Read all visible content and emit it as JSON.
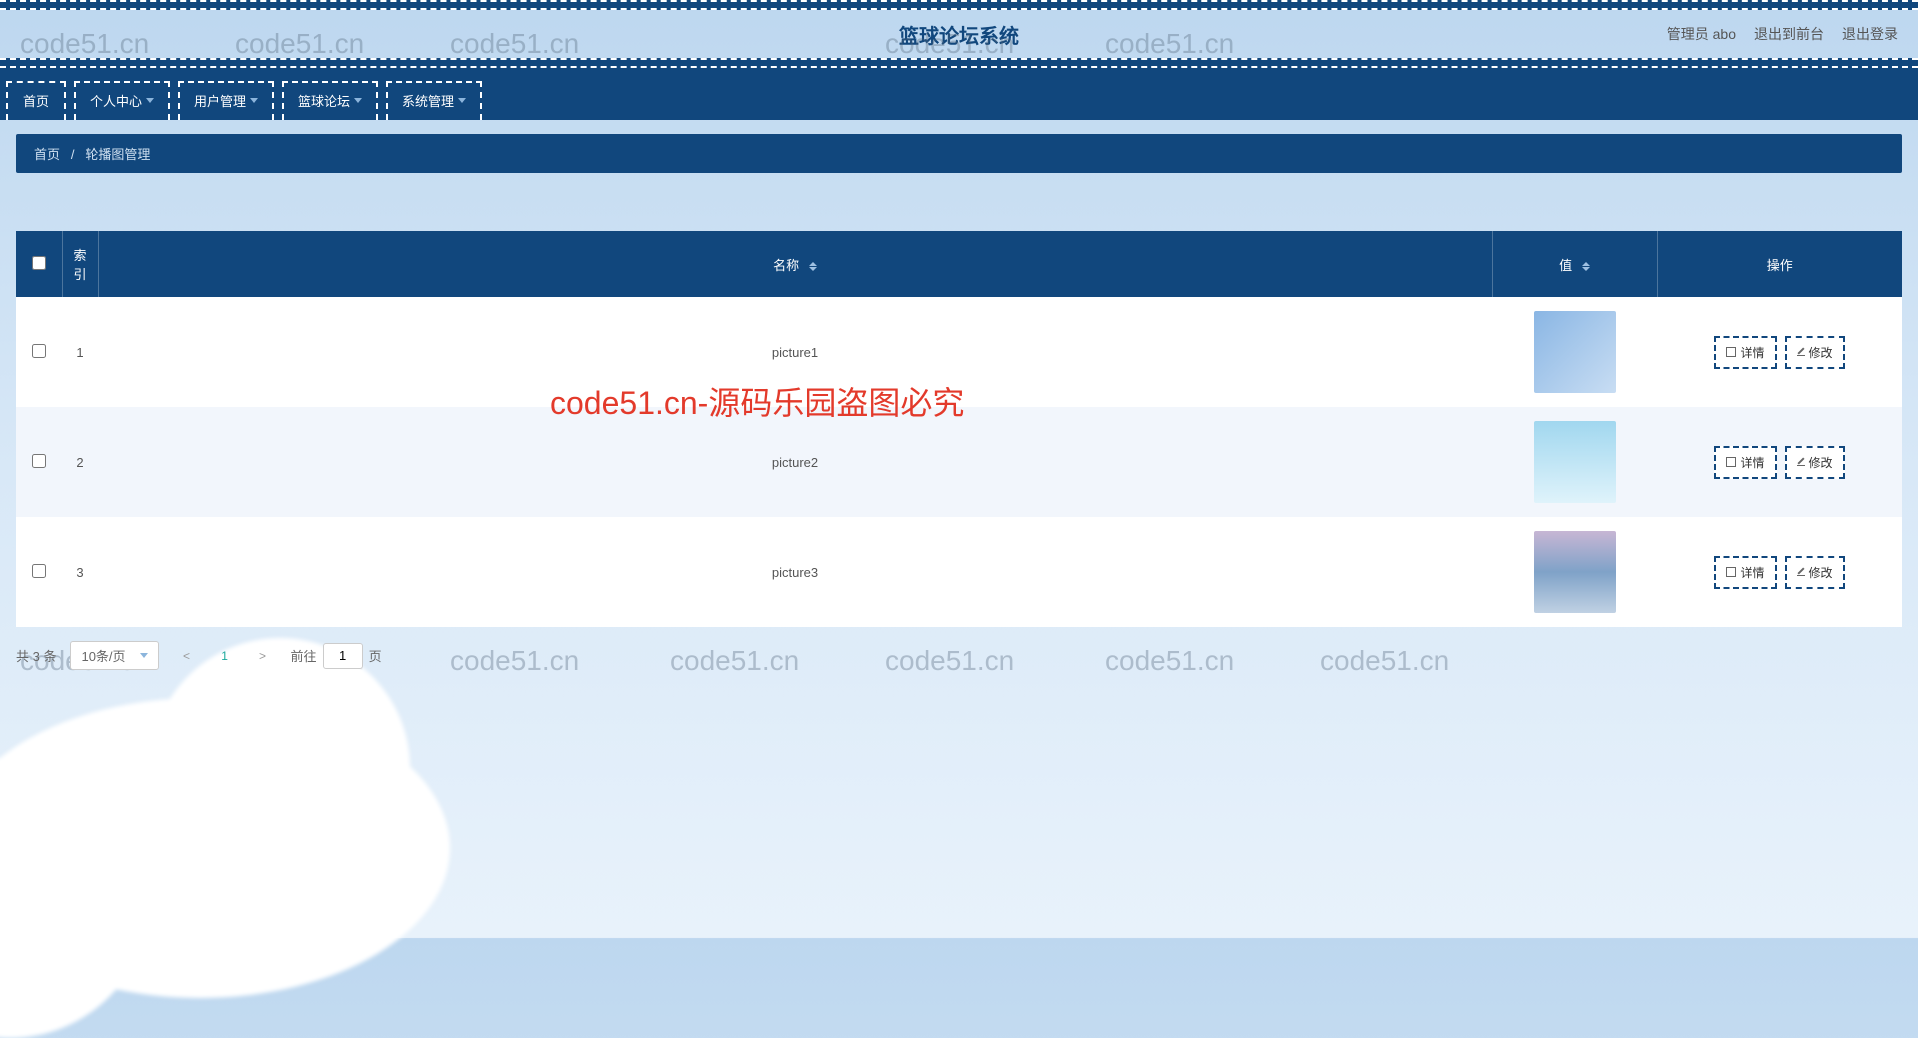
{
  "header": {
    "title": "篮球论坛系统",
    "userPrefix": "管理员",
    "userName": "abo",
    "logoutToFront": "退出到前台",
    "logout": "退出登录"
  },
  "nav": {
    "items": [
      {
        "label": "首页",
        "dropdown": false
      },
      {
        "label": "个人中心",
        "dropdown": true
      },
      {
        "label": "用户管理",
        "dropdown": true
      },
      {
        "label": "篮球论坛",
        "dropdown": true
      },
      {
        "label": "系统管理",
        "dropdown": true
      }
    ]
  },
  "breadcrumb": {
    "home": "首页",
    "sep": "/",
    "current": "轮播图管理"
  },
  "table": {
    "headers": {
      "index": "索引",
      "name": "名称",
      "value": "值",
      "action": "操作"
    },
    "rows": [
      {
        "idx": "1",
        "name": "picture1"
      },
      {
        "idx": "2",
        "name": "picture2"
      },
      {
        "idx": "3",
        "name": "picture3"
      }
    ],
    "actions": {
      "detail": "详情",
      "edit": "修改"
    }
  },
  "pagination": {
    "total": "共 3 条",
    "perPage": "10条/页",
    "currentPage": "1",
    "gotoLabel": "前往",
    "gotoValue": "1",
    "pageSuffix": "页"
  },
  "watermarks": {
    "text": "code51.cn",
    "red": "code51.cn-源码乐园盗图必究"
  }
}
